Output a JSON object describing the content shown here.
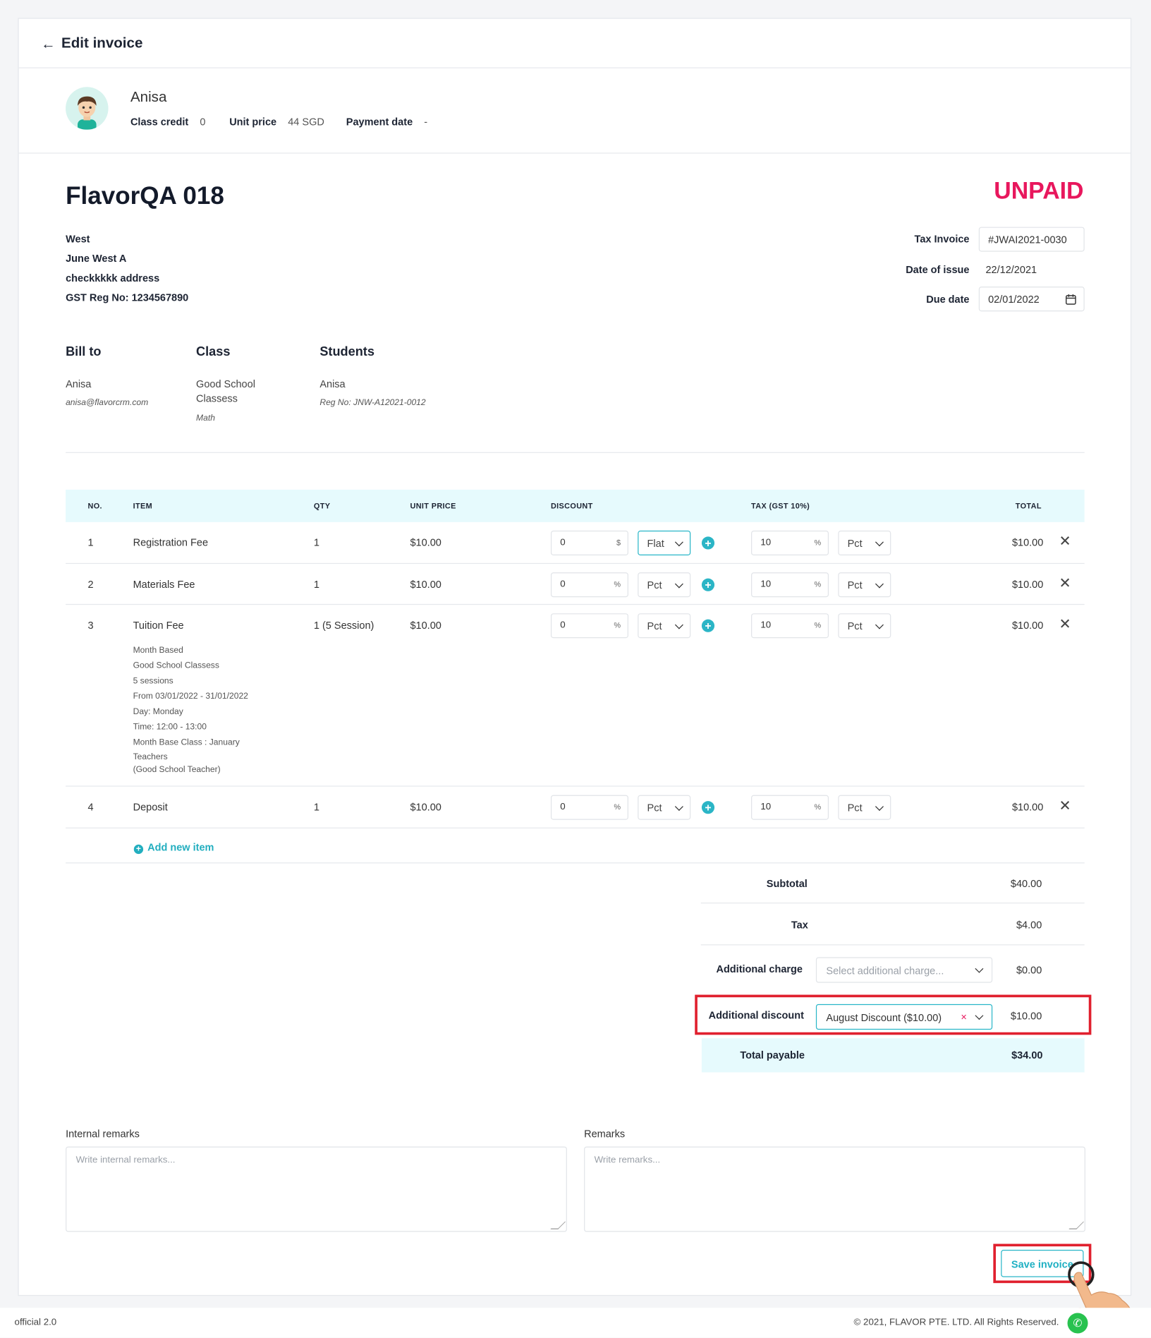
{
  "header": {
    "back_icon": "←",
    "title": "Edit invoice"
  },
  "student": {
    "name": "Anisa",
    "class_credit_label": "Class credit",
    "class_credit_value": "0",
    "unit_price_label": "Unit price",
    "unit_price_value": "44 SGD",
    "payment_date_label": "Payment date",
    "payment_date_value": "-"
  },
  "invoice": {
    "title": "FlavorQA 018",
    "status": "UNPAID",
    "address": [
      "West",
      "June West A",
      "checkkkkk address",
      "GST Reg No: 1234567890"
    ],
    "tax_invoice_label": "Tax Invoice",
    "tax_invoice_value": "#JWAI2021-0030",
    "date_issue_label": "Date of issue",
    "date_issue_value": "22/12/2021",
    "due_date_label": "Due date",
    "due_date_value": "02/01/2022"
  },
  "bill_to": {
    "heading": "Bill to",
    "name": "Anisa",
    "email": "anisa@flavorcrm.com"
  },
  "class": {
    "heading": "Class",
    "name": "Good School Classess",
    "subject": "Math"
  },
  "students": {
    "heading": "Students",
    "name": "Anisa",
    "reg": "Reg No: JNW-A12021-0012"
  },
  "table": {
    "headers": [
      "NO.",
      "ITEM",
      "QTY",
      "UNIT PRICE",
      "DISCOUNT",
      "TAX (GST 10%)",
      "TOTAL"
    ],
    "rows": [
      {
        "no": "1",
        "item": "Registration Fee",
        "qty": "1",
        "price": "$10.00",
        "disc": "0",
        "disc_suffix": "$",
        "disc_type": "Flat",
        "tax": "10",
        "tax_suffix": "%",
        "tax_type": "Pct",
        "total": "$10.00"
      },
      {
        "no": "2",
        "item": "Materials Fee",
        "qty": "1",
        "price": "$10.00",
        "disc": "0",
        "disc_suffix": "%",
        "disc_type": "Pct",
        "tax": "10",
        "tax_suffix": "%",
        "tax_type": "Pct",
        "total": "$10.00"
      },
      {
        "no": "3",
        "item": "Tuition Fee",
        "qty": "1 (5 Session)",
        "price": "$10.00",
        "disc": "0",
        "disc_suffix": "%",
        "disc_type": "Pct",
        "tax": "10",
        "tax_suffix": "%",
        "tax_type": "Pct",
        "total": "$10.00",
        "details": [
          "Month Based",
          "Good School Classess",
          "5 sessions",
          "From 03/01/2022 - 31/01/2022",
          "Day: Monday",
          "Time: 12:00 - 13:00",
          "Month Base Class : January",
          "Teachers",
          "(Good School Teacher)"
        ]
      },
      {
        "no": "4",
        "item": "Deposit",
        "qty": "1",
        "price": "$10.00",
        "disc": "0",
        "disc_suffix": "%",
        "disc_type": "Pct",
        "tax": "10",
        "tax_suffix": "%",
        "tax_type": "Pct",
        "total": "$10.00"
      }
    ],
    "add_item": "Add new item"
  },
  "summary": {
    "subtotal_label": "Subtotal",
    "subtotal_value": "$40.00",
    "tax_label": "Tax",
    "tax_value": "$4.00",
    "charge_label": "Additional charge",
    "charge_placeholder": "Select additional charge...",
    "charge_value": "$0.00",
    "discount_label": "Additional discount",
    "discount_selected": "August Discount ($10.00)",
    "discount_clear": "×",
    "discount_value": "$10.00",
    "total_label": "Total payable",
    "total_value": "$34.00"
  },
  "remarks": {
    "internal_label": "Internal remarks",
    "internal_placeholder": "Write internal remarks...",
    "label": "Remarks",
    "placeholder": "Write remarks..."
  },
  "save_label": "Save invoice",
  "footer": {
    "version": "official 2.0",
    "copyright": "© 2021, FLAVOR PTE. LTD. All Rights Reserved."
  },
  "colors": {
    "accent": "#22aebf",
    "status": "#e8175d",
    "highlight": "#e0202e"
  }
}
